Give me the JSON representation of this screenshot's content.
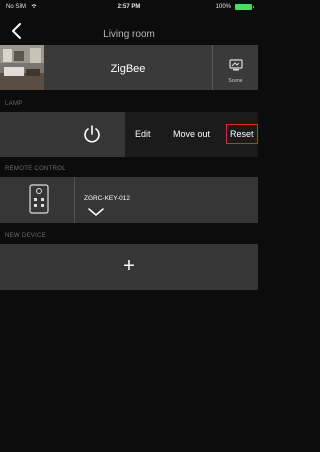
{
  "status_bar": {
    "carrier": "No SIM",
    "time": "2:57 PM",
    "battery": "100%"
  },
  "nav": {
    "title": "Living room"
  },
  "gateway": {
    "name": "ZigBee",
    "scene_label": "Scene"
  },
  "sections": {
    "lamp": "LAMP",
    "remote": "REMOTE CONTROL",
    "new_device": "NEW DEVICE"
  },
  "lamp": {
    "actions": {
      "edit": "Edit",
      "move_out": "Move out",
      "reset": "Reset"
    }
  },
  "remote": {
    "device_name": "ZGRC-KEY-012"
  },
  "new_device": {
    "add_glyph": "+"
  },
  "icons": [
    "wifi-icon",
    "back-arrow-icon",
    "room-thumbnail",
    "scene-icon",
    "power-icon",
    "remote-control-icon",
    "chevron-down-icon",
    "plus-icon"
  ],
  "colors": {
    "background": "#0c0c0c",
    "row": "#363636",
    "reset_border": "#e1262b",
    "battery": "#4cd964"
  }
}
